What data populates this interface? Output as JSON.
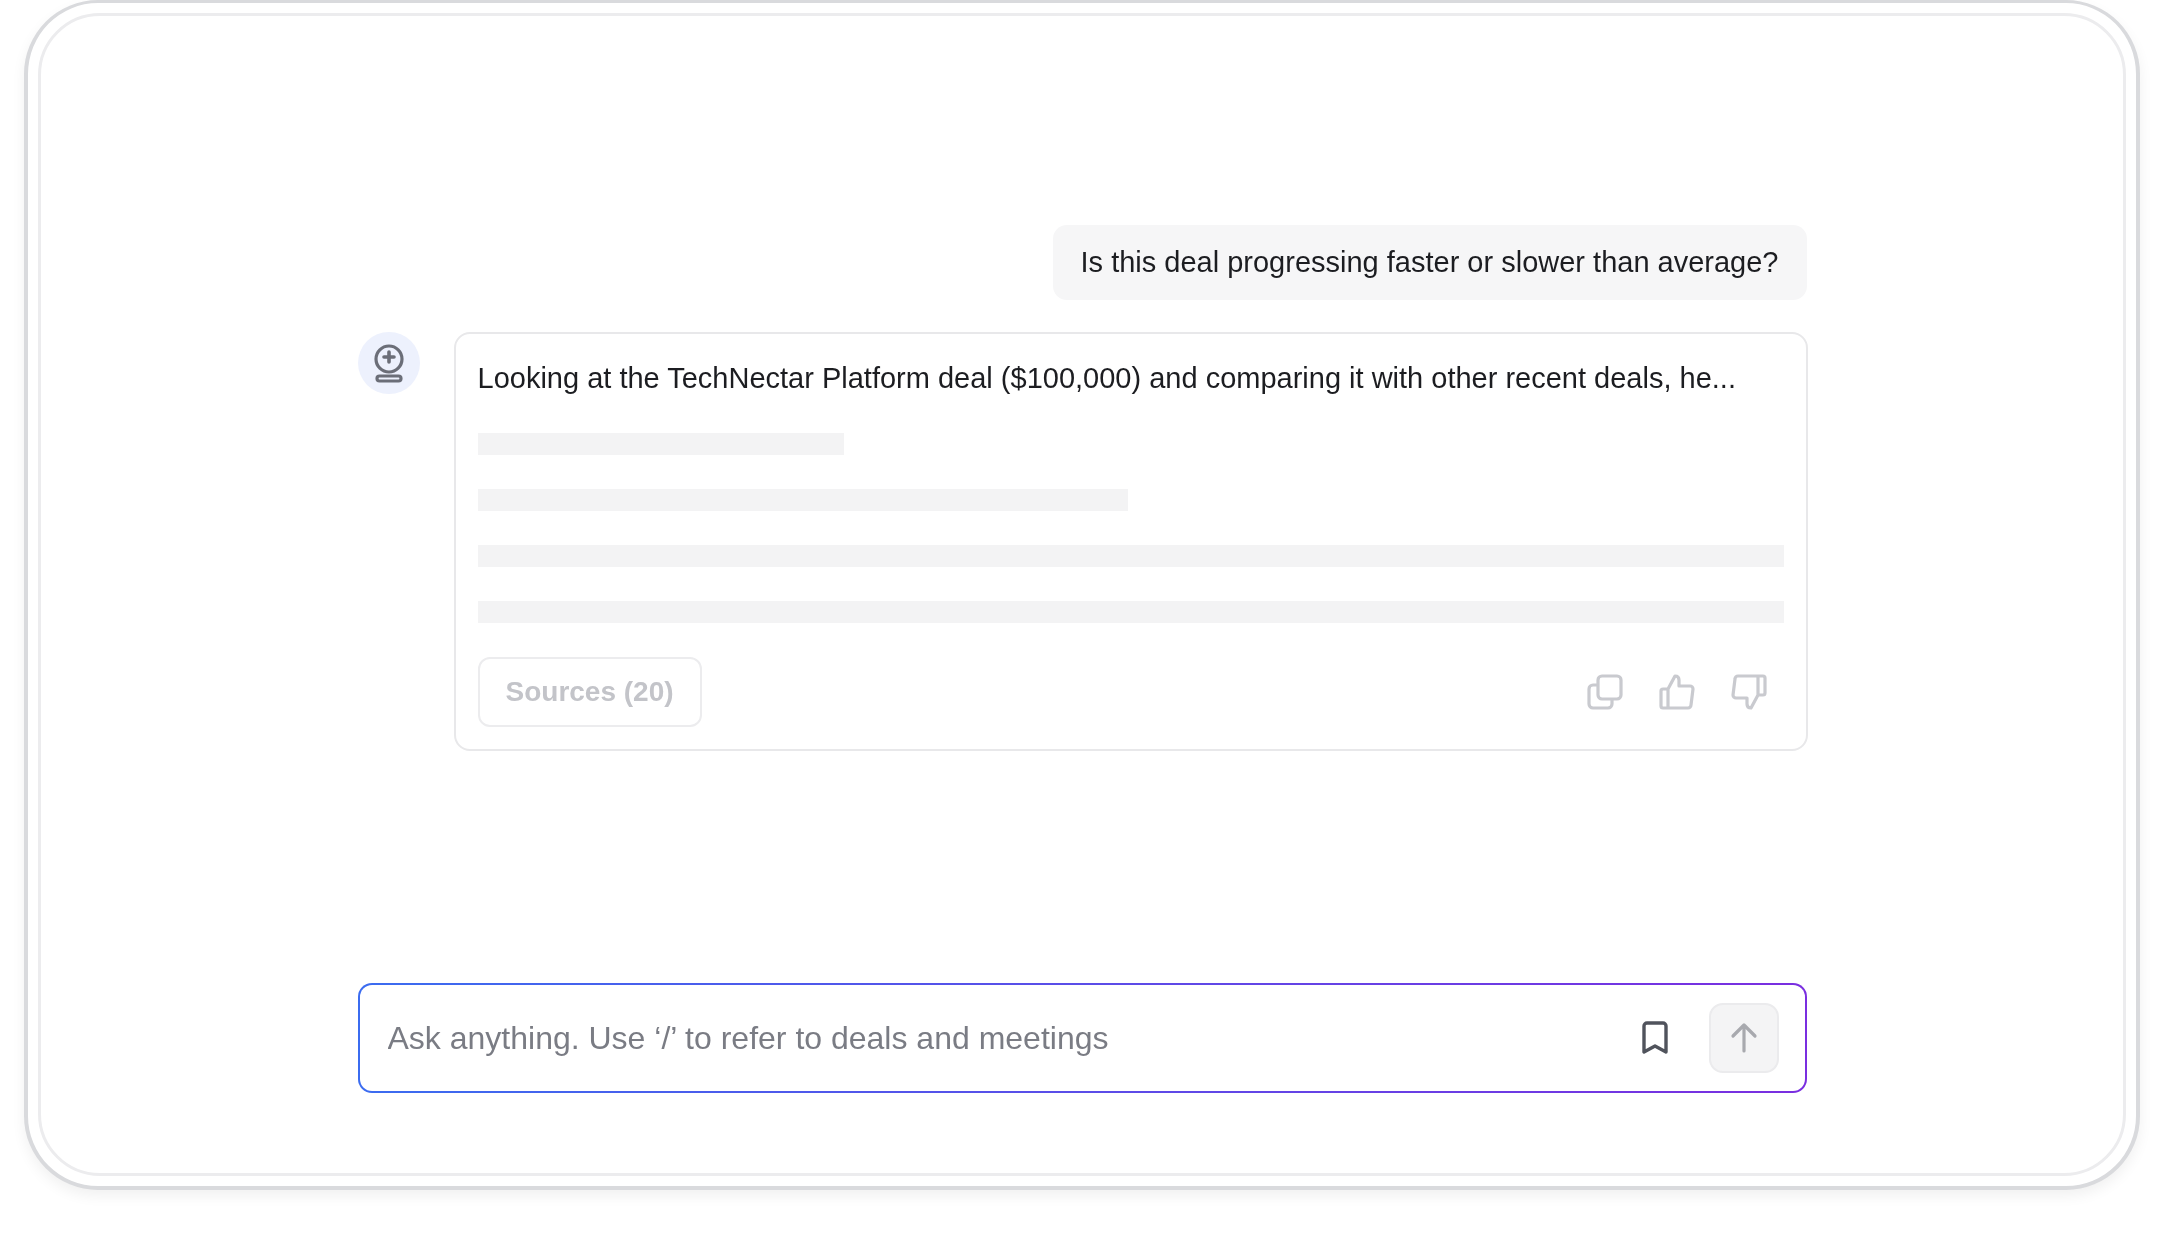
{
  "user_message": {
    "text": "Is this deal progressing faster or slower than average?"
  },
  "assistant_message": {
    "text": "Looking at the TechNectar Platform deal ($100,000) and comparing it with other recent deals, he...",
    "sources_label": "Sources (20)"
  },
  "composer": {
    "placeholder": "Ask anything. Use ‘/’ to refer to deals and meetings",
    "send_disabled": true
  }
}
